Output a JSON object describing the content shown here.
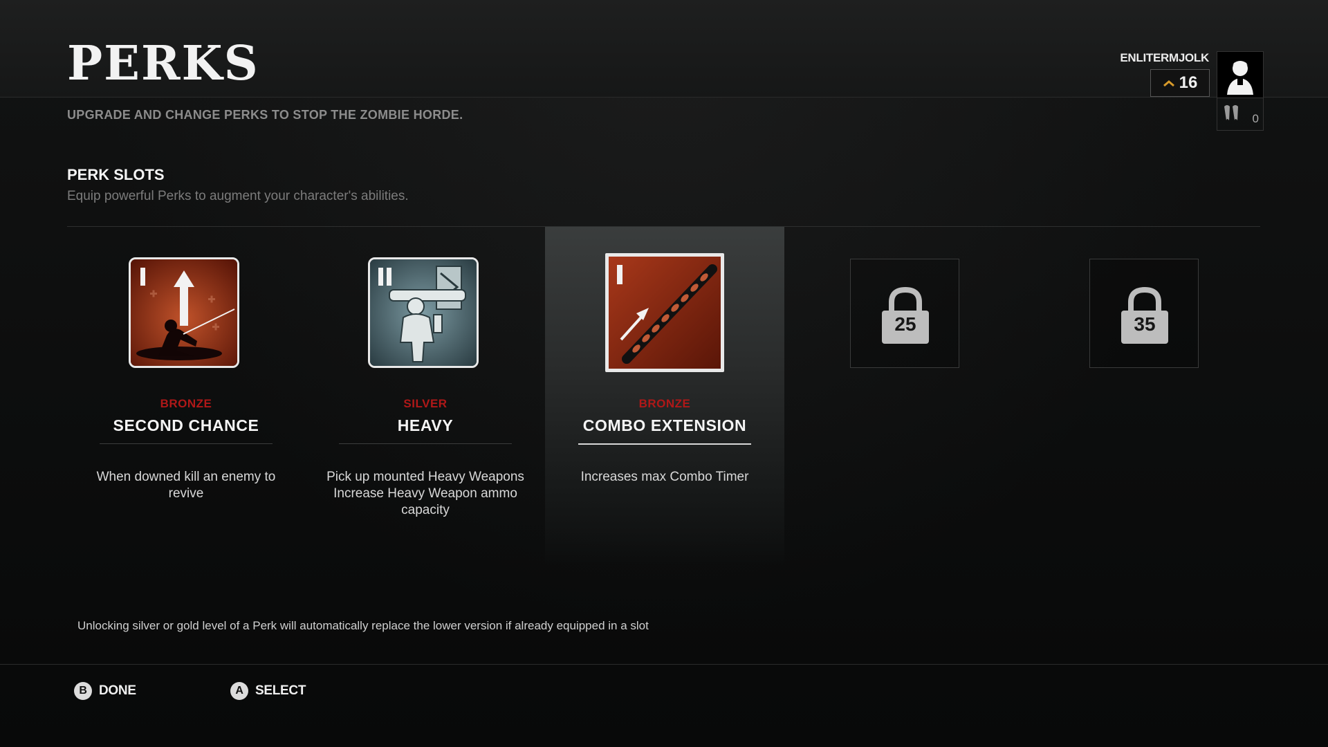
{
  "header": {
    "title": "PERKS",
    "subtitle": "UPGRADE AND CHANGE PERKS TO STOP THE ZOMBIE HORDE."
  },
  "player": {
    "name": "ENLITERMJOLK",
    "level": "16",
    "currency": "0",
    "level_icon": "chevron-rank-icon",
    "avatar_icon": "player-avatar-icon",
    "currency_icon": "tooth-currency-icon"
  },
  "section": {
    "title": "PERK SLOTS",
    "description": "Equip powerful Perks to augment your character's abilities."
  },
  "perks": [
    {
      "tier": "BRONZE",
      "rank_numeral": "I",
      "name": "SECOND CHANCE",
      "description": "When downed kill an enemy to revive",
      "icon": "second-chance-icon",
      "selected": false
    },
    {
      "tier": "SILVER",
      "rank_numeral": "II",
      "name": "HEAVY",
      "description": "Pick up mounted Heavy Weapons Increase Heavy Weapon ammo capacity",
      "icon": "heavy-weapon-icon",
      "selected": false
    },
    {
      "tier": "BRONZE",
      "rank_numeral": "I",
      "name": "COMBO EXTENSION",
      "description": "Increases max Combo Timer",
      "icon": "combo-chain-icon",
      "selected": true
    }
  ],
  "locked_slots": [
    {
      "unlock_level": "25",
      "icon": "padlock-icon"
    },
    {
      "unlock_level": "35",
      "icon": "padlock-icon"
    }
  ],
  "footnote": "Unlocking silver or gold level of a Perk will automatically replace the lower version if already equipped in a slot",
  "footer": {
    "done": {
      "glyph": "B",
      "label": "DONE"
    },
    "select": {
      "glyph": "A",
      "label": "SELECT"
    }
  },
  "colors": {
    "tier_red": "#b01818",
    "selected_panel": "#3a3d3d",
    "level_chevron": "#d79a2a"
  }
}
